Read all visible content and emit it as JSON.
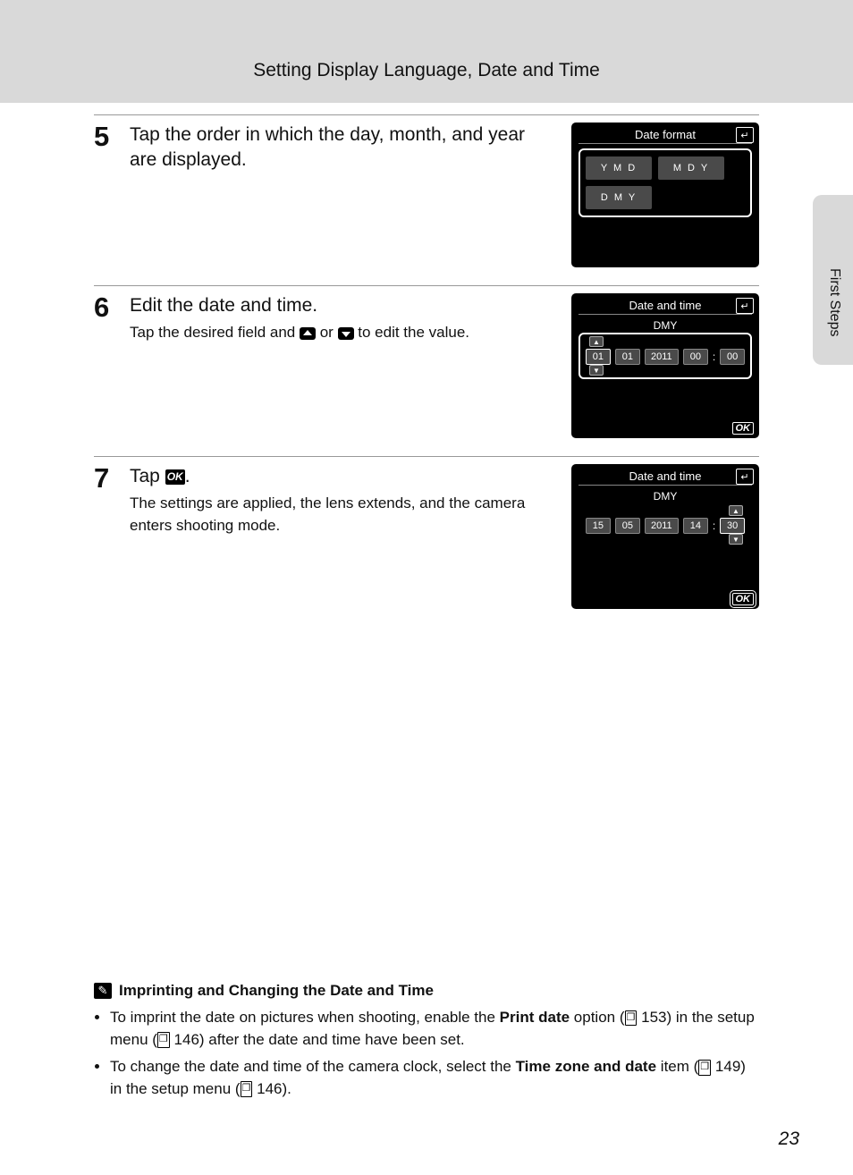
{
  "header": "Setting Display Language, Date and Time",
  "side_tab": "First Steps",
  "page_number": "23",
  "steps": {
    "s5": {
      "num": "5",
      "title": "Tap the order in which the day, month, and year are displayed.",
      "screen": {
        "title": "Date format",
        "opts": [
          "Y  M  D",
          "M  D  Y",
          "D  M  Y"
        ]
      }
    },
    "s6": {
      "num": "6",
      "title": "Edit the date and time.",
      "sub_a": "Tap the desired field and ",
      "sub_or": " or ",
      "sub_b": " to edit the value.",
      "screen": {
        "title": "Date and time",
        "sub": "DMY",
        "fields": [
          "01",
          "01",
          "2011",
          "00",
          "00"
        ],
        "sel": "left",
        "ok": "OK"
      }
    },
    "s7": {
      "num": "7",
      "title_a": "Tap ",
      "ok": "OK",
      "title_b": ".",
      "sub": "The settings are applied, the lens extends, and the camera enters shooting mode.",
      "screen": {
        "title": "Date and time",
        "sub": "DMY",
        "fields": [
          "15",
          "05",
          "2011",
          "14",
          "30"
        ],
        "sel": "right",
        "ok": "OK"
      }
    }
  },
  "note": {
    "title": "Imprinting and Changing the Date and Time",
    "b1_a": "To imprint the date on pictures when shooting, enable the ",
    "b1_bold": "Print date",
    "b1_b": " option (",
    "b1_ref1": "153",
    "b1_c": ") in the setup menu (",
    "b1_ref2": "146",
    "b1_d": ") after the date and time have been set.",
    "b2_a": "To change the date and time of the camera clock, select the ",
    "b2_bold": "Time zone and date",
    "b2_b": " item (",
    "b2_ref1": "149",
    "b2_c": ") in the setup menu (",
    "b2_ref2": "146",
    "b2_d": ")."
  }
}
